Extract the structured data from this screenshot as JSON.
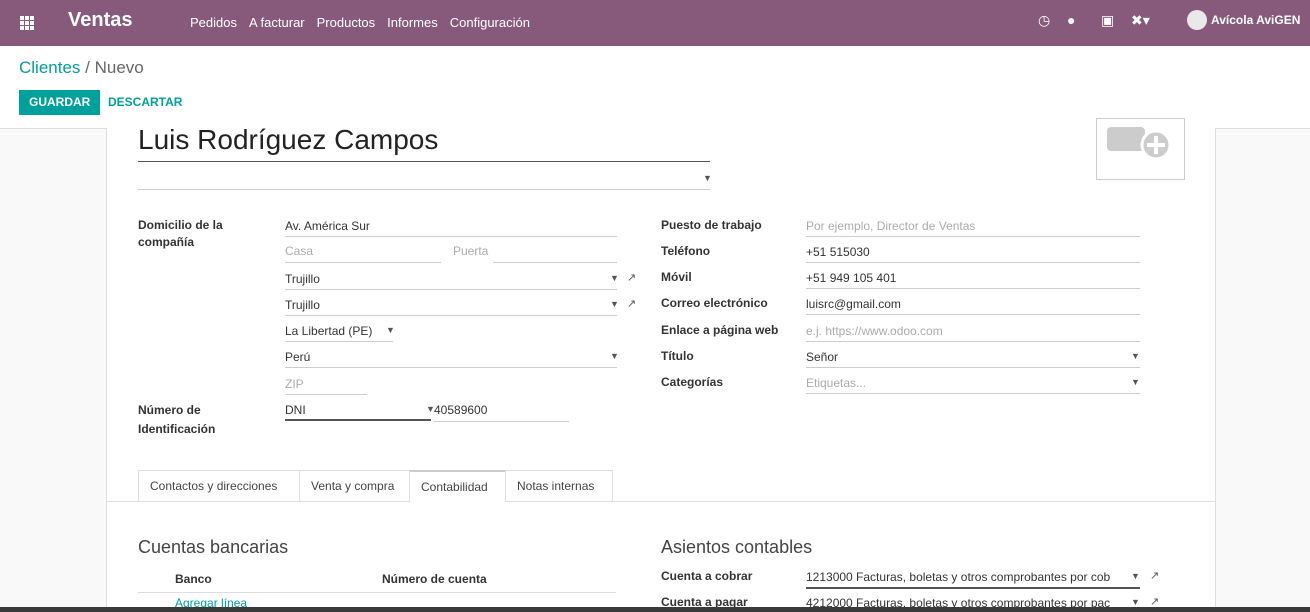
{
  "navbar": {
    "brand": "Ventas",
    "menu": [
      "Pedidos",
      "A facturar",
      "Productos",
      "Informes",
      "Configuración"
    ],
    "user": "Avícola AviGEN"
  },
  "breadcrumb": {
    "parent": "Clientes",
    "separator": "/",
    "current": "Nuevo"
  },
  "actions": {
    "save": "GUARDAR",
    "discard": "DESCARTAR"
  },
  "partner": {
    "name": "Luis Rodríguez Campos"
  },
  "address": {
    "label": "Domicilio de la compañía",
    "street": "Av. América Sur",
    "street2_ph": "Casa",
    "door_ph": "Puerta",
    "province": "Trujillo",
    "district": "Trujillo",
    "state": "La Libertad (PE)",
    "country": "Perú",
    "zip_ph": "ZIP"
  },
  "identification": {
    "label": "Número de Identificación",
    "type": "DNI",
    "number": "40589600"
  },
  "right": {
    "job_label": "Puesto de trabajo",
    "job_ph": "Por ejemplo, Director de Ventas",
    "phone_label": "Teléfono",
    "phone": "+51 515030",
    "mobile_label": "Móvil",
    "mobile": "+51 949 105 401",
    "email_label": "Correo electrónico",
    "email": "luisrc@gmail.com",
    "web_label": "Enlace a página web",
    "web_ph": "e.j. https://www.odoo.com",
    "title_label": "Título",
    "title": "Señor",
    "tags_label": "Categorías",
    "tags_ph": "Etiquetas..."
  },
  "tabs": [
    "Contactos y direcciones",
    "Venta y compra",
    "Contabilidad",
    "Notas internas"
  ],
  "bank": {
    "heading": "Cuentas bancarias",
    "col_bank": "Banco",
    "col_account": "Número de cuenta",
    "add_line": "Agregar línea"
  },
  "accounting": {
    "heading": "Asientos contables",
    "receivable_label": "Cuenta a cobrar",
    "receivable": "1213000 Facturas, boletas y otros comprobantes por cob",
    "payable_label": "Cuenta a pagar",
    "payable": "4212000 Facturas, boletas y otros comprobantes por pac"
  },
  "colors": {
    "navbar": "#875a7b",
    "accent": "#00a09d"
  }
}
